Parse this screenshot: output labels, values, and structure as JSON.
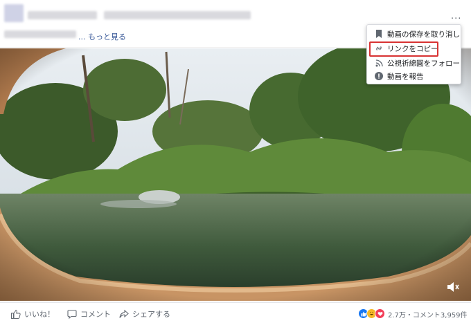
{
  "header": {
    "more_link": "... もっと見る",
    "more_options": "···"
  },
  "menu": {
    "items": [
      {
        "label": "動画の保存を取り消し",
        "icon": "bookmark-icon"
      },
      {
        "label": "リンクをコピー",
        "icon": "link-icon"
      },
      {
        "label": "公視祈綿圓をフォロー",
        "icon": "rss-icon"
      },
      {
        "label": "動画を報告",
        "icon": "alert-icon"
      }
    ]
  },
  "actions": {
    "like": "いいね！",
    "comment": "コメント",
    "share": "シェアする"
  },
  "stats": {
    "reactions": "2.7万",
    "comments": "・コメント3,959件"
  },
  "colors": {
    "link": "#385898",
    "highlight": "#d83232",
    "like_blue": "#1877f2",
    "haha_yellow": "#f7b928",
    "love_red": "#f33e58"
  }
}
